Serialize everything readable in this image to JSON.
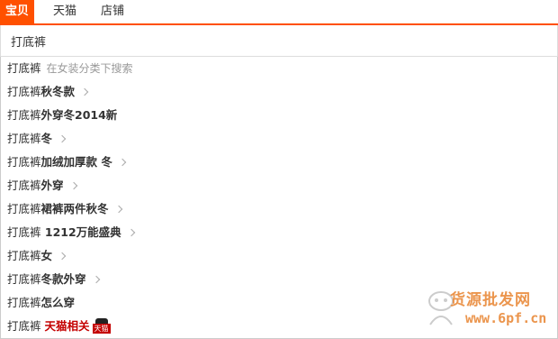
{
  "tabs": [
    {
      "label": "宝贝",
      "active": true
    },
    {
      "label": "天猫",
      "active": false
    },
    {
      "label": "店铺",
      "active": false
    }
  ],
  "search": {
    "value": "打底裤"
  },
  "suggestions": [
    {
      "query": "打底裤",
      "hint": "在女装分类下搜索"
    },
    {
      "prefix": "打底裤",
      "rest": "秋冬款",
      "arrow": true
    },
    {
      "prefix": "打底裤",
      "rest": "外穿冬2014新",
      "arrow": false
    },
    {
      "prefix": "打底裤",
      "rest": "冬",
      "arrow": true
    },
    {
      "prefix": "打底裤",
      "rest": "加绒加厚款 冬",
      "arrow": true
    },
    {
      "prefix": "打底裤",
      "rest": "外穿",
      "arrow": true
    },
    {
      "prefix": "打底裤",
      "rest": "裙裤两件秋冬",
      "arrow": true
    },
    {
      "prefix": "打底裤",
      "rest": " 1212万能盛典",
      "arrow": true
    },
    {
      "prefix": "打底裤",
      "rest": "女",
      "arrow": true
    },
    {
      "prefix": "打底裤",
      "rest": "冬款外穿",
      "arrow": true
    },
    {
      "prefix": "打底裤",
      "rest": "怎么穿",
      "arrow": false
    },
    {
      "prefix": "打底裤",
      "tmall_label": "天猫相关",
      "tmall_badge": "天猫"
    }
  ],
  "watermark": {
    "text": "货源批发网",
    "url": "www.6pf.cn"
  },
  "colors": {
    "accent": "#ff5000",
    "tmall_red": "#c40000",
    "hint_gray": "#999999"
  }
}
